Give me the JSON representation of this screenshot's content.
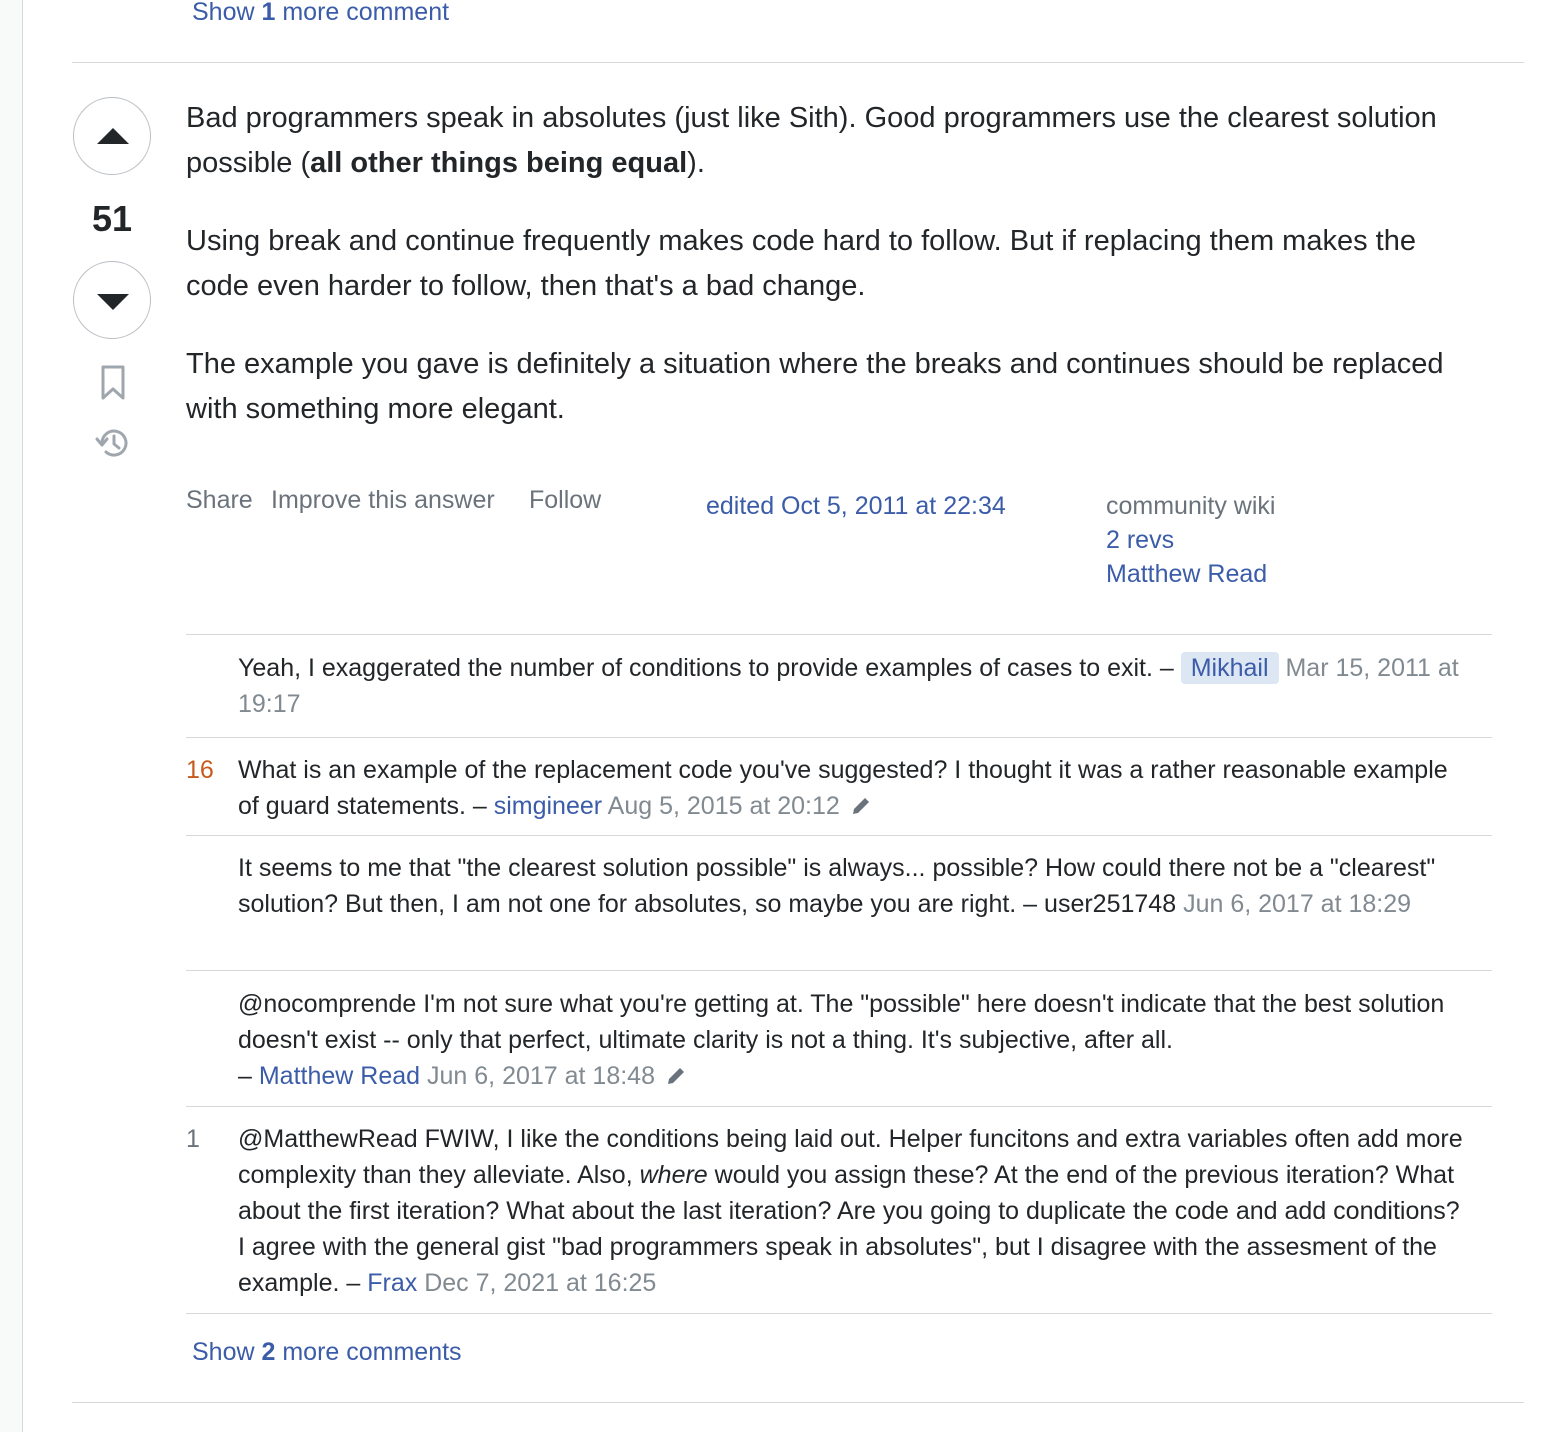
{
  "top_show_more": {
    "prefix": "Show ",
    "count": "1",
    "suffix": " more comment"
  },
  "answer": {
    "score": "51",
    "paragraphs": {
      "p1_a": "Bad programmers speak in absolutes (just like Sith). Good programmers use the clearest solution possible (",
      "p1_bold": "all other things being equal",
      "p1_b": ").",
      "p2": "Using break and continue frequently makes code hard to follow. But if replacing them makes the code even harder to follow, then that's a bad change.",
      "p3": "The example you gave is definitely a situation where the breaks and continues should be replaced with something more elegant."
    },
    "menu": {
      "share": "Share",
      "improve": "Improve this answer",
      "follow": "Follow"
    },
    "edited": "edited Oct 5, 2011 at 22:34",
    "wiki": {
      "label": "community wiki",
      "revs": "2 revs",
      "editor": "Matthew Read"
    }
  },
  "icons": {
    "upvote": "upvote-arrow-icon",
    "downvote": "downvote-arrow-icon",
    "bookmark": "bookmark-icon",
    "history": "history-icon",
    "edit": "pencil-icon"
  },
  "comments": [
    {
      "score": "",
      "text": "Yeah, I exaggerated the number of conditions to provide examples of cases to exit. –",
      "user": "Mikhail",
      "date": "Mar 15, 2011 at 19:17"
    },
    {
      "score": "16",
      "text": "What is an example of the replacement code you've suggested? I thought it was a rather reasonable example of guard statements. –",
      "user": "simgineer",
      "date": "Aug 5, 2015 at 20:12"
    },
    {
      "score": "",
      "text": "It seems to me that \"the clearest solution possible\" is always... possible? How could there not be a \"clearest\" solution? But then, I am not one for absolutes, so maybe you are right. –",
      "user": "user251748",
      "date": "Jun 6, 2017 at 18:29"
    },
    {
      "score": "",
      "text": "@nocomprende I'm not sure what you're getting at. The \"possible\" here doesn't indicate that the best solution doesn't exist -- only that perfect, ultimate clarity is not a thing. It's subjective, after all.",
      "dash": "–",
      "user": "Matthew Read",
      "date": "Jun 6, 2017 at 18:48"
    },
    {
      "score": "1",
      "text_a": "@MatthewRead FWIW, I like the conditions being laid out. Helper funcitons and extra variables often add more complexity than they alleviate. Also,",
      "text_em": "where",
      "text_b": "would you assign these? At the end of the previous iteration? What about the first iteration? What about the last iteration? Are you going to duplicate the code and add conditions? I agree with the general gist \"bad programmers speak in absolutes\", but I disagree with the assesment of the example. –",
      "user": "Frax",
      "date": "Dec 7, 2021 at 16:25"
    }
  ],
  "bottom_show_more": {
    "prefix": "Show ",
    "count": "2",
    "suffix": " more comments"
  }
}
